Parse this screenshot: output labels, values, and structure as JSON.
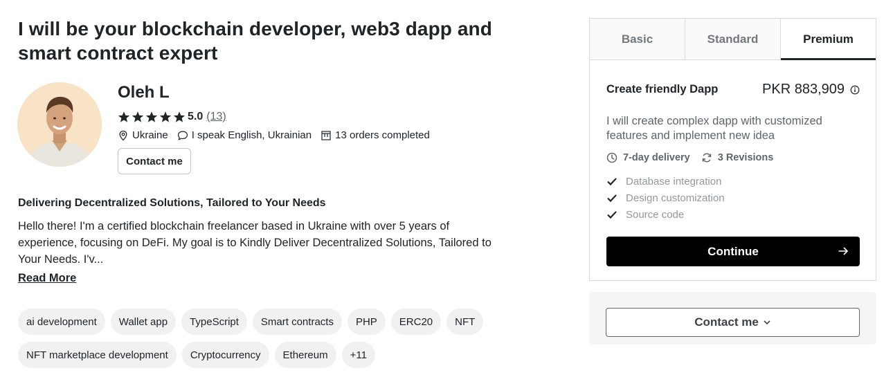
{
  "gig": {
    "title": "I will be your blockchain developer, web3 dapp and smart contract expert"
  },
  "seller": {
    "name": "Oleh L",
    "rating": "5.0",
    "rating_stars": 5,
    "reviews": "(13)",
    "country": "Ukraine",
    "languages": "I speak English, Ukrainian",
    "orders": "13 orders completed",
    "contact_label": "Contact me"
  },
  "description": {
    "heading": "Delivering Decentralized Solutions, Tailored to Your Needs",
    "body": "Hello there! I'm a certified blockchain freelancer based in Ukraine with over 5 years of experience, focusing on DeFi. My goal is to Kindly Deliver Decentralized Solutions, Tailored to Your Needs. I'v...",
    "read_more": "Read More"
  },
  "tags": [
    "ai development",
    "Wallet app",
    "TypeScript",
    "Smart contracts",
    "PHP",
    "ERC20",
    "NFT",
    "NFT marketplace development",
    "Cryptocurrency",
    "Ethereum",
    "+11"
  ],
  "package_panel": {
    "tabs": [
      "Basic",
      "Standard",
      "Premium"
    ],
    "active_tab": "Premium",
    "name": "Create friendly Dapp",
    "price": "PKR 883,909",
    "description": "I will create complex dapp with customized features and implement new idea",
    "delivery": "7-day delivery",
    "revisions": "3 Revisions",
    "features": [
      "Database integration",
      "Design customization",
      "Source code"
    ],
    "continue_label": "Continue"
  },
  "contact_box": {
    "label": "Contact me"
  },
  "icons": {
    "star": "star-icon",
    "location": "location-pin-icon",
    "chat": "chat-bubble-icon",
    "orders": "orders-box-icon",
    "info": "info-icon",
    "clock": "clock-icon",
    "revisions": "refresh-icon",
    "check": "check-icon",
    "arrow": "arrow-right-icon",
    "chevron": "chevron-down-icon"
  },
  "colors": {
    "text_primary": "#222325",
    "text_secondary": "#62646a",
    "text_muted": "#95979d",
    "button_primary": "#000000",
    "tag_background": "#f1f1f2",
    "avatar_background": "#f8e3c7"
  }
}
